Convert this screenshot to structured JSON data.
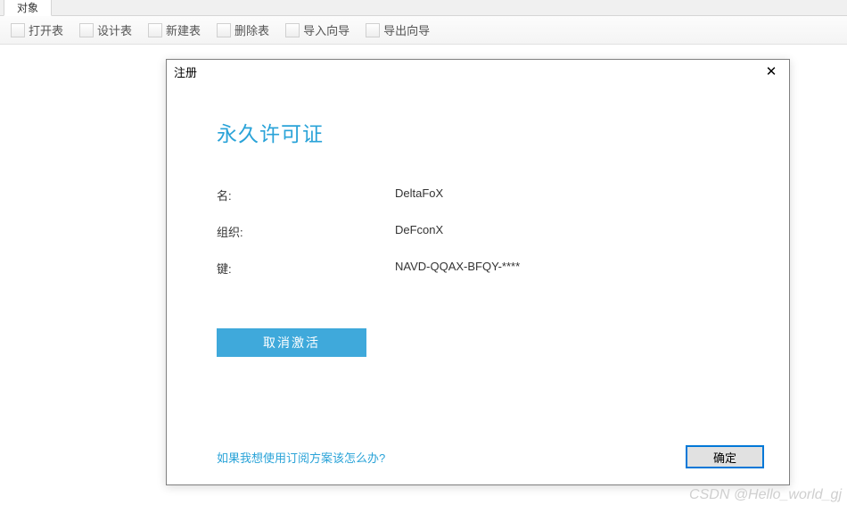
{
  "tabs": {
    "active": "对象"
  },
  "toolbar": {
    "open_table": "打开表",
    "design_table": "设计表",
    "new_table": "新建表",
    "delete_table": "删除表",
    "import_wizard": "导入向导",
    "export_wizard": "导出向导"
  },
  "dialog": {
    "title": "注册",
    "heading": "永久许可证",
    "labels": {
      "name": "名:",
      "org": "组织:",
      "key": "键:"
    },
    "values": {
      "name": "DeltaFoX",
      "org": "DeFconX",
      "key": "NAVD-QQAX-BFQY-****"
    },
    "deactivate": "取消激活",
    "sub_link": "如果我想使用订阅方案该怎么办?",
    "ok": "确定"
  },
  "watermark": "CSDN @Hello_world_gj"
}
